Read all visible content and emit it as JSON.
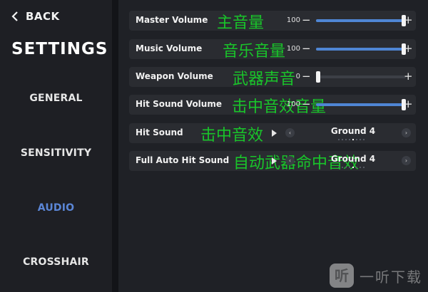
{
  "sidebar": {
    "back_label": "BACK",
    "title": "SETTINGS",
    "items": [
      {
        "label": "GENERAL"
      },
      {
        "label": "SENSITIVITY"
      },
      {
        "label": "AUDIO",
        "active": true
      },
      {
        "label": "CROSSHAIR"
      }
    ]
  },
  "rows": {
    "master_volume": {
      "label": "Master Volume",
      "overlay": "主音量",
      "value": "100",
      "level": 1.0
    },
    "music_volume": {
      "label": "Music Volume",
      "overlay": "音乐音量",
      "value": "100",
      "level": 1.0
    },
    "weapon_volume": {
      "label": "Weapon Volume",
      "overlay": "武器声音",
      "value": "0",
      "level": 0.0
    },
    "hit_sound_volume": {
      "label": "Hit Sound Volume",
      "overlay": "击中音效音量",
      "value": "100",
      "level": 1.0
    },
    "hit_sound": {
      "label": "Hit Sound",
      "overlay": "击中音效",
      "selected": "Ground 4",
      "option_index": 4,
      "option_count": 8
    },
    "full_auto_hit_sound": {
      "label": "Full Auto Hit Sound",
      "overlay": "自动武器命中音效",
      "selected": "Ground 4",
      "option_index": 4,
      "option_count": 8
    }
  },
  "controls": {
    "minus": "−",
    "plus": "+",
    "prev": "‹",
    "next": "›"
  },
  "watermark": {
    "badge": "听",
    "text": "一听下载"
  },
  "colors": {
    "accent": "#4f86d4",
    "active_nav": "#5b86d6",
    "overlay_text": "#19c52a"
  }
}
